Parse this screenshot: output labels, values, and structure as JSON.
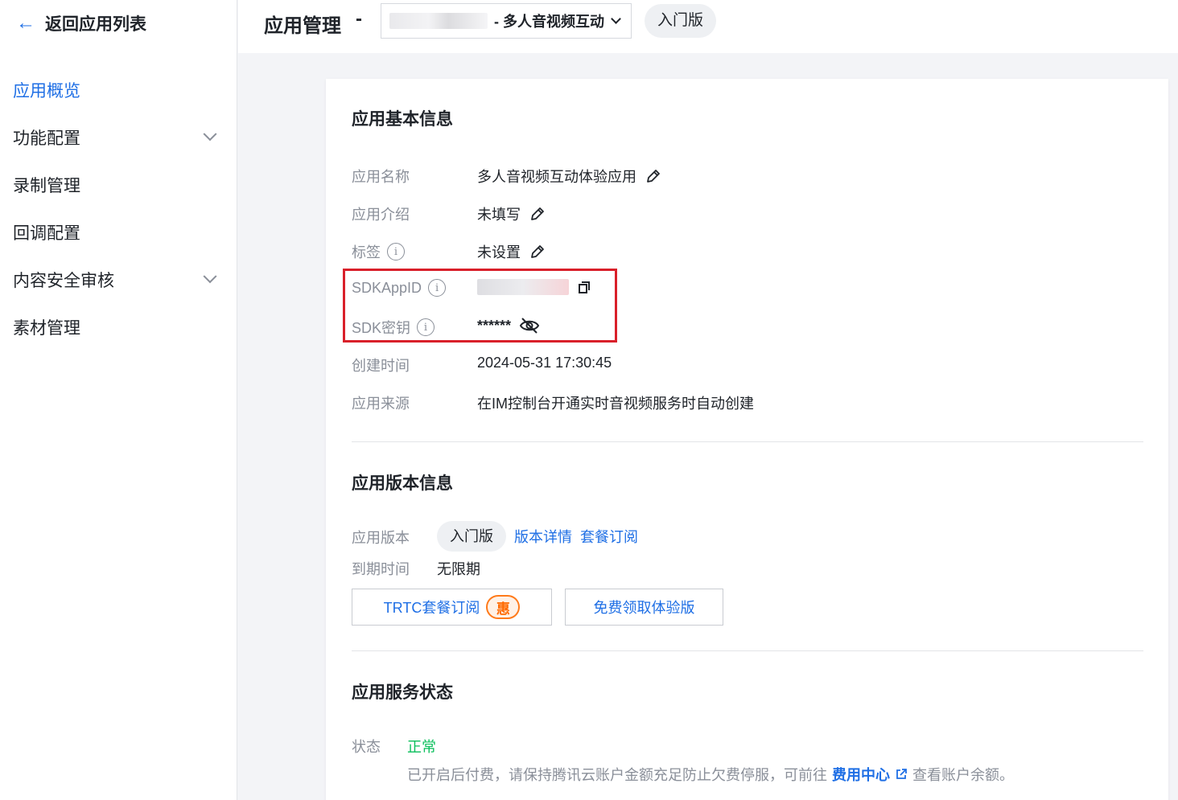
{
  "sidebar": {
    "back_label": "返回应用列表",
    "items": [
      {
        "label": "应用概览",
        "active": true,
        "expandable": false
      },
      {
        "label": "功能配置",
        "active": false,
        "expandable": true
      },
      {
        "label": "录制管理",
        "active": false,
        "expandable": false
      },
      {
        "label": "回调配置",
        "active": false,
        "expandable": false
      },
      {
        "label": "内容安全审核",
        "active": false,
        "expandable": true
      },
      {
        "label": "素材管理",
        "active": false,
        "expandable": false
      }
    ]
  },
  "header": {
    "title": "应用管理",
    "dash": "-",
    "app_select_text": "- 多人音视频互动",
    "edition": "入门版"
  },
  "basic_info": {
    "title": "应用基本信息",
    "fields": {
      "app_name": {
        "label": "应用名称",
        "value": "多人音视频互动体验应用"
      },
      "app_intro": {
        "label": "应用介绍",
        "value": "未填写"
      },
      "tags": {
        "label": "标签",
        "value": "未设置"
      },
      "sdk_app_id": {
        "label": "SDKAppID"
      },
      "sdk_key": {
        "label": "SDK密钥",
        "value": "******"
      },
      "created_at": {
        "label": "创建时间",
        "value": "2024-05-31 17:30:45"
      },
      "source": {
        "label": "应用来源",
        "value": "在IM控制台开通实时音视频服务时自动创建"
      }
    }
  },
  "version_info": {
    "title": "应用版本信息",
    "version_label": "应用版本",
    "version_value": "入门版",
    "version_detail_link": "版本详情",
    "subscribe_link": "套餐订阅",
    "expire_label": "到期时间",
    "expire_value": "无限期",
    "trtc_button": "TRTC套餐订阅",
    "trtc_badge": "惠",
    "trial_button": "免费领取体验版"
  },
  "service_status": {
    "title": "应用服务状态",
    "status_label": "状态",
    "status_value": "正常",
    "notice_prefix": "已开启后付费，请保持腾讯云账户金额充足防止欠费停服，可前往",
    "notice_link": "费用中心",
    "notice_suffix": "查看账户余额。"
  },
  "colors": {
    "accent": "#1f6fe5",
    "highlight": "#d9202a",
    "status_ok": "#0abf5b",
    "badge": "#ff6a00"
  },
  "icons": [
    "arrow-left-icon",
    "chevron-down-icon",
    "pencil-icon",
    "info-icon",
    "copy-icon",
    "eye-off-icon",
    "external-link-icon"
  ]
}
